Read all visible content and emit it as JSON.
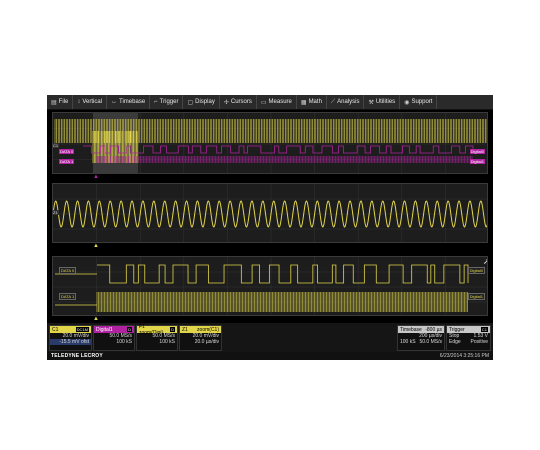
{
  "menu": [
    {
      "label": "File",
      "icon": "file-icon",
      "glyph": "▤"
    },
    {
      "label": "Vertical",
      "icon": "vertical-icon",
      "glyph": "↕"
    },
    {
      "label": "Timebase",
      "icon": "timebase-icon",
      "glyph": "↔"
    },
    {
      "label": "Trigger",
      "icon": "trigger-icon",
      "glyph": "⌐"
    },
    {
      "label": "Display",
      "icon": "display-icon",
      "glyph": "▢"
    },
    {
      "label": "Cursors",
      "icon": "cursors-icon",
      "glyph": "✢"
    },
    {
      "label": "Measure",
      "icon": "measure-icon",
      "glyph": "▭"
    },
    {
      "label": "Math",
      "icon": "math-icon",
      "glyph": "▦"
    },
    {
      "label": "Analysis",
      "icon": "analysis-icon",
      "glyph": "⟋"
    },
    {
      "label": "Utilities",
      "icon": "utilities-icon",
      "glyph": "⚒"
    },
    {
      "label": "Support",
      "icon": "support-icon",
      "glyph": "◉"
    }
  ],
  "grid1": {
    "ch_label": "C1",
    "data_labels": [
      "DATA 0",
      "DATA 1"
    ],
    "digital_labels": [
      "Digital0",
      "Digital1"
    ]
  },
  "grid2": {
    "ch_label": "Z1"
  },
  "grid3": {
    "data_labels": [
      "DATA 0",
      "DATA 1"
    ],
    "digital_labels": [
      "Digital0",
      "Digital1"
    ]
  },
  "descriptors": {
    "c1": {
      "name": "C1",
      "tag": "DC1M",
      "line1": "20.0 mV/div",
      "line2": "-15.5 mV ofst"
    },
    "digital": {
      "name": "Digital1",
      "tag": "D",
      "line1": "50.0 MS/s",
      "line2": "100 kS"
    },
    "f1": {
      "name": "F1",
      "title": "zoom(Digi)",
      "tag": "D",
      "line1": "50.0 MS/s",
      "line2": "100 kS"
    },
    "z1": {
      "name": "Z1",
      "title": "zoom(C1)",
      "line1": "20.0 mV/div",
      "line2": "20.0 µs/div"
    },
    "timebase": {
      "label": "Timebase",
      "value": "-800 µs",
      "line1a": "200 µs/div",
      "line2a": "100 kS",
      "line2b": "50.0 MS/s"
    },
    "trigger": {
      "label": "Trigger",
      "tag": "C1",
      "line1a": "Stop",
      "line1b": "1.53 V",
      "line2a": "Edge",
      "line2b": "Positive"
    }
  },
  "brand": "TELEDYNE LECROY",
  "datetime": "6/23/2014 3:25:16 PM",
  "colors": {
    "yellow": "#e1d54a",
    "pink": "#b0229f",
    "grid_bg": "#1d1d1d",
    "bg": "#000000"
  }
}
